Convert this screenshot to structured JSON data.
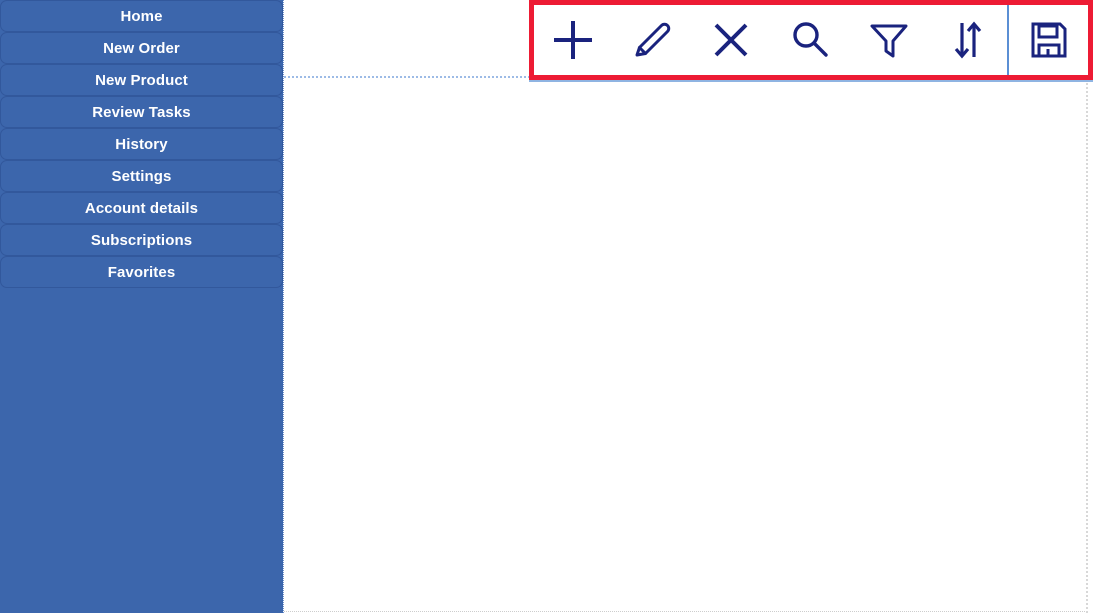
{
  "app": {
    "accent_blue": "#3C66AC",
    "icon_navy": "#1A237E",
    "highlight_red": "#ED1B34",
    "panel_white": "#FFFFFF"
  },
  "sidebar": {
    "name": "main-navigation",
    "items": [
      {
        "id": "home",
        "label": "Home"
      },
      {
        "id": "new-order",
        "label": "New Order"
      },
      {
        "id": "new-product",
        "label": "New Product"
      },
      {
        "id": "review-tasks",
        "label": "Review Tasks"
      },
      {
        "id": "history",
        "label": "History"
      },
      {
        "id": "settings",
        "label": "Settings"
      },
      {
        "id": "account-details",
        "label": "Account details"
      },
      {
        "id": "subscriptions",
        "label": "Subscriptions"
      },
      {
        "id": "favorites",
        "label": "Favorites"
      }
    ]
  },
  "toolbar": {
    "name": "record-actions-toolbar",
    "highlighted": true,
    "buttons": [
      {
        "id": "add",
        "icon": "plus-icon",
        "label": "Add"
      },
      {
        "id": "edit",
        "icon": "pencil-icon",
        "label": "Edit"
      },
      {
        "id": "delete",
        "icon": "close-x-icon",
        "label": "Delete"
      },
      {
        "id": "search",
        "icon": "search-icon",
        "label": "Search"
      },
      {
        "id": "filter",
        "icon": "filter-funnel-icon",
        "label": "Filter"
      },
      {
        "id": "sort",
        "icon": "sort-arrows-icon",
        "label": "Sort"
      },
      {
        "id": "save",
        "icon": "save-floppy-icon",
        "label": "Save"
      }
    ]
  },
  "content": {
    "name": "main-content-panel",
    "body_text": ""
  }
}
